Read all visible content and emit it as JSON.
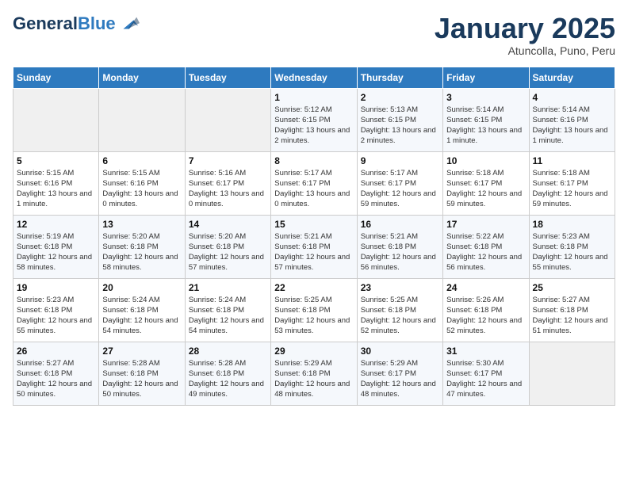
{
  "logo": {
    "line1": "General",
    "line2": "Blue"
  },
  "title": "January 2025",
  "subtitle": "Atuncolla, Puno, Peru",
  "weekdays": [
    "Sunday",
    "Monday",
    "Tuesday",
    "Wednesday",
    "Thursday",
    "Friday",
    "Saturday"
  ],
  "weeks": [
    [
      {
        "day": "",
        "empty": true
      },
      {
        "day": "",
        "empty": true
      },
      {
        "day": "",
        "empty": true
      },
      {
        "day": "1",
        "sunrise": "5:12 AM",
        "sunset": "6:15 PM",
        "daylight": "13 hours and 2 minutes."
      },
      {
        "day": "2",
        "sunrise": "5:13 AM",
        "sunset": "6:15 PM",
        "daylight": "13 hours and 2 minutes."
      },
      {
        "day": "3",
        "sunrise": "5:14 AM",
        "sunset": "6:15 PM",
        "daylight": "13 hours and 1 minute."
      },
      {
        "day": "4",
        "sunrise": "5:14 AM",
        "sunset": "6:16 PM",
        "daylight": "13 hours and 1 minute."
      }
    ],
    [
      {
        "day": "5",
        "sunrise": "5:15 AM",
        "sunset": "6:16 PM",
        "daylight": "13 hours and 1 minute."
      },
      {
        "day": "6",
        "sunrise": "5:15 AM",
        "sunset": "6:16 PM",
        "daylight": "13 hours and 0 minutes."
      },
      {
        "day": "7",
        "sunrise": "5:16 AM",
        "sunset": "6:17 PM",
        "daylight": "13 hours and 0 minutes."
      },
      {
        "day": "8",
        "sunrise": "5:17 AM",
        "sunset": "6:17 PM",
        "daylight": "13 hours and 0 minutes."
      },
      {
        "day": "9",
        "sunrise": "5:17 AM",
        "sunset": "6:17 PM",
        "daylight": "12 hours and 59 minutes."
      },
      {
        "day": "10",
        "sunrise": "5:18 AM",
        "sunset": "6:17 PM",
        "daylight": "12 hours and 59 minutes."
      },
      {
        "day": "11",
        "sunrise": "5:18 AM",
        "sunset": "6:17 PM",
        "daylight": "12 hours and 59 minutes."
      }
    ],
    [
      {
        "day": "12",
        "sunrise": "5:19 AM",
        "sunset": "6:18 PM",
        "daylight": "12 hours and 58 minutes."
      },
      {
        "day": "13",
        "sunrise": "5:20 AM",
        "sunset": "6:18 PM",
        "daylight": "12 hours and 58 minutes."
      },
      {
        "day": "14",
        "sunrise": "5:20 AM",
        "sunset": "6:18 PM",
        "daylight": "12 hours and 57 minutes."
      },
      {
        "day": "15",
        "sunrise": "5:21 AM",
        "sunset": "6:18 PM",
        "daylight": "12 hours and 57 minutes."
      },
      {
        "day": "16",
        "sunrise": "5:21 AM",
        "sunset": "6:18 PM",
        "daylight": "12 hours and 56 minutes."
      },
      {
        "day": "17",
        "sunrise": "5:22 AM",
        "sunset": "6:18 PM",
        "daylight": "12 hours and 56 minutes."
      },
      {
        "day": "18",
        "sunrise": "5:23 AM",
        "sunset": "6:18 PM",
        "daylight": "12 hours and 55 minutes."
      }
    ],
    [
      {
        "day": "19",
        "sunrise": "5:23 AM",
        "sunset": "6:18 PM",
        "daylight": "12 hours and 55 minutes."
      },
      {
        "day": "20",
        "sunrise": "5:24 AM",
        "sunset": "6:18 PM",
        "daylight": "12 hours and 54 minutes."
      },
      {
        "day": "21",
        "sunrise": "5:24 AM",
        "sunset": "6:18 PM",
        "daylight": "12 hours and 54 minutes."
      },
      {
        "day": "22",
        "sunrise": "5:25 AM",
        "sunset": "6:18 PM",
        "daylight": "12 hours and 53 minutes."
      },
      {
        "day": "23",
        "sunrise": "5:25 AM",
        "sunset": "6:18 PM",
        "daylight": "12 hours and 52 minutes."
      },
      {
        "day": "24",
        "sunrise": "5:26 AM",
        "sunset": "6:18 PM",
        "daylight": "12 hours and 52 minutes."
      },
      {
        "day": "25",
        "sunrise": "5:27 AM",
        "sunset": "6:18 PM",
        "daylight": "12 hours and 51 minutes."
      }
    ],
    [
      {
        "day": "26",
        "sunrise": "5:27 AM",
        "sunset": "6:18 PM",
        "daylight": "12 hours and 50 minutes."
      },
      {
        "day": "27",
        "sunrise": "5:28 AM",
        "sunset": "6:18 PM",
        "daylight": "12 hours and 50 minutes."
      },
      {
        "day": "28",
        "sunrise": "5:28 AM",
        "sunset": "6:18 PM",
        "daylight": "12 hours and 49 minutes."
      },
      {
        "day": "29",
        "sunrise": "5:29 AM",
        "sunset": "6:18 PM",
        "daylight": "12 hours and 48 minutes."
      },
      {
        "day": "30",
        "sunrise": "5:29 AM",
        "sunset": "6:17 PM",
        "daylight": "12 hours and 48 minutes."
      },
      {
        "day": "31",
        "sunrise": "5:30 AM",
        "sunset": "6:17 PM",
        "daylight": "12 hours and 47 minutes."
      },
      {
        "day": "",
        "empty": true
      }
    ]
  ]
}
